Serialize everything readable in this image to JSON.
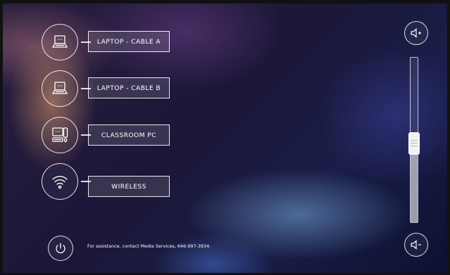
{
  "sources": [
    {
      "label": "LAPTOP - CABLE A",
      "icon": "laptop-icon"
    },
    {
      "label": "LAPTOP - CABLE B",
      "icon": "laptop-icon"
    },
    {
      "label": "CLASSROOM PC",
      "icon": "desktop-pc-icon"
    },
    {
      "label": "WIRELESS",
      "icon": "wifi-icon"
    }
  ],
  "volume": {
    "up_icon": "volume-up-icon",
    "down_icon": "volume-down-icon",
    "level": 0.48
  },
  "footer": {
    "power_icon": "power-icon",
    "assistance_text": "For assistance, contact Media Services, 646-997-3934."
  }
}
